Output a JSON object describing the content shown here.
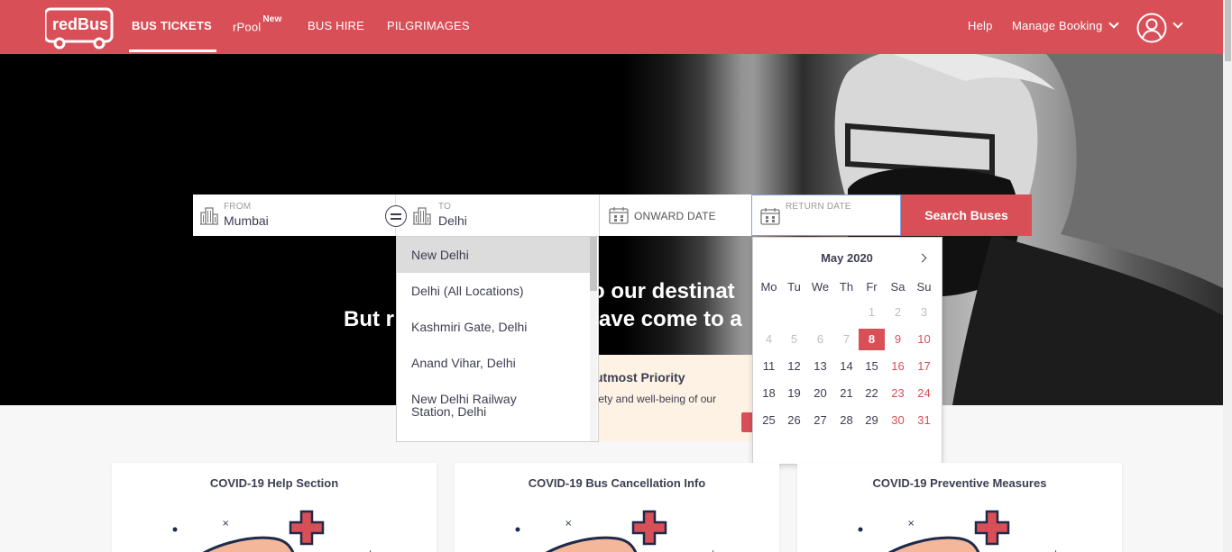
{
  "brand": "redBus",
  "nav": {
    "bus_tickets": "BUS TICKETS",
    "rpool": "rPool",
    "rpool_badge": "New",
    "bus_hire": "BUS HIRE",
    "pilgrimages": "PILGRIMAGES",
    "help": "Help",
    "manage_booking": "Manage Booking"
  },
  "hero": {
    "line1": "o our destinat",
    "line2_a": "But r",
    "line2_b": "ave come to a",
    "priority_title": "utmost Priority",
    "priority_text": "fety and well-being of our"
  },
  "search": {
    "from_label": "FROM",
    "from_value": "Mumbai",
    "to_label": "TO",
    "to_value": "Delhi",
    "onward_placeholder": "ONWARD DATE",
    "return_label": "RETURN DATE",
    "button": "Search Buses"
  },
  "suggestions": [
    {
      "name": "New Delhi",
      "selected": true
    },
    {
      "name": "Delhi (All Locations)",
      "selected": false
    },
    {
      "name": "Kashmiri Gate, Delhi",
      "selected": false
    },
    {
      "name": "Anand Vihar, Delhi",
      "selected": false
    },
    {
      "name": "New Delhi Railway Station, Delhi",
      "selected": false
    }
  ],
  "calendar": {
    "month": "May 2020",
    "weekdays": [
      "Mo",
      "Tu",
      "We",
      "Th",
      "Fr",
      "Sa",
      "Su"
    ],
    "first_weekday_index": 4,
    "days_in_month": 31,
    "today": 8
  },
  "cards": [
    {
      "title": "COVID-19 Help Section"
    },
    {
      "title": "COVID-19 Bus Cancellation Info"
    },
    {
      "title": "COVID-19 Preventive Measures"
    }
  ],
  "colors": {
    "brand_red": "#d84f57",
    "text_dark": "#3e3e52"
  },
  "icons": [
    "redbus-logo-icon",
    "chevron-down-icon",
    "user-avatar-icon",
    "building-icon",
    "swap-icon",
    "calendar-icon",
    "chevron-right-icon",
    "medical-cross-icon"
  ]
}
